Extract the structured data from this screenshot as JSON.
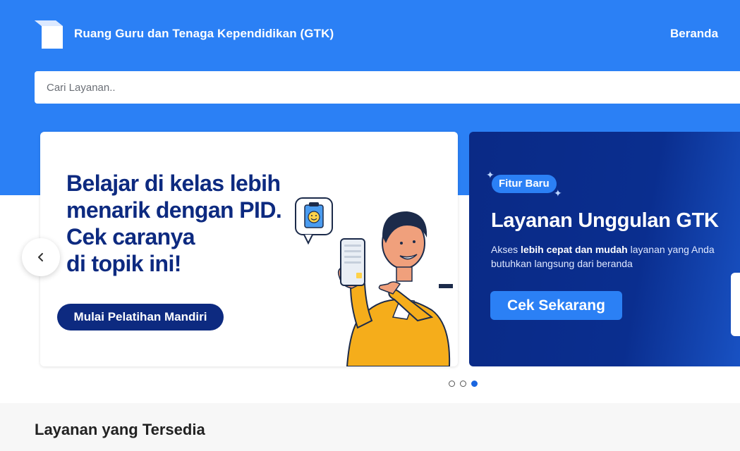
{
  "header": {
    "site_title": "Ruang Guru dan Tenaga Kependidikan (GTK)",
    "nav_home": "Beranda"
  },
  "search": {
    "placeholder": "Cari Layanan.."
  },
  "carousel": {
    "slide_pid": {
      "headline_lines": [
        "Belajar di kelas lebih",
        "menarik dengan PID.",
        "Cek caranya",
        "di topik ini!"
      ],
      "button_label": "Mulai Pelatihan Mandiri"
    },
    "slide_gtk": {
      "badge": "Fitur Baru",
      "title": "Layanan Unggulan GTK",
      "desc_prefix": "Akses ",
      "desc_bold": "lebih cepat dan mudah",
      "desc_suffix": " layanan yang Anda butuhkan langsung dari beranda",
      "button_label": "Cek Sekarang"
    },
    "dots_count": 3,
    "active_dot": 3
  },
  "services": {
    "title": "Layanan yang Tersedia"
  },
  "colors": {
    "primary_blue": "#2b80f5",
    "navy": "#0d2a80"
  },
  "icons": {
    "logo": "book-logo-icon",
    "prev": "chevron-left-icon"
  }
}
